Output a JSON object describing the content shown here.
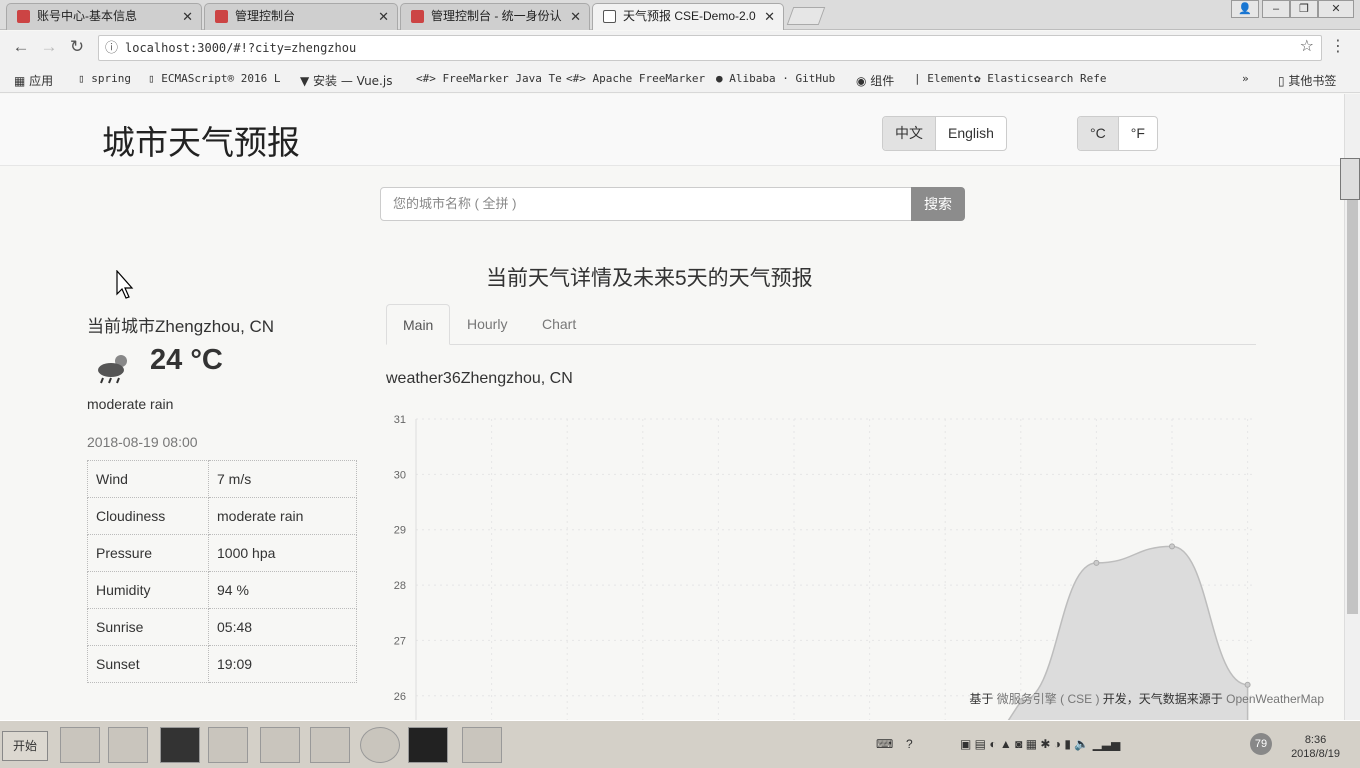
{
  "browser": {
    "tabs": [
      {
        "title": "账号中心-基本信息"
      },
      {
        "title": "管理控制台"
      },
      {
        "title": "管理控制台 - 统一身份认"
      },
      {
        "title": "天气预报 CSE-Demo-2.0"
      }
    ],
    "url": "localhost:3000/#!?city=zhengzhou",
    "bookmarks": [
      "应用",
      "spring",
      "ECMAScript® 2016 L",
      "安装 — Vue.js",
      "FreeMarker Java Te",
      "Apache FreeMarker",
      "Alibaba · GitHub",
      "组件",
      "Element",
      "Elasticsearch Refe",
      "其他书签"
    ]
  },
  "header": {
    "title": "城市天气预报",
    "lang_options": [
      "中文",
      "English"
    ],
    "unit_options": [
      "°C",
      "°F"
    ]
  },
  "search": {
    "placeholder": "您的城市名称 ( 全拼 )",
    "button": "搜索"
  },
  "section_title": "当前天气详情及未来5天的天气预报",
  "current": {
    "city": "当前城市Zhengzhou, CN",
    "temp": "24 °C",
    "description": "moderate rain",
    "time": "2018-08-19 08:00",
    "details": [
      {
        "k": "Wind",
        "v": "7 m/s"
      },
      {
        "k": "Cloudiness",
        "v": "moderate rain"
      },
      {
        "k": "Pressure",
        "v": "1000 hpa"
      },
      {
        "k": "Humidity",
        "v": "94 %"
      },
      {
        "k": "Sunrise",
        "v": "05:48"
      },
      {
        "k": "Sunset",
        "v": "19:09"
      }
    ]
  },
  "tabs": [
    "Main",
    "Hourly",
    "Chart"
  ],
  "chart_title": "weather36Zhengzhou, CN",
  "chart_data": {
    "type": "area",
    "y_ticks": [
      26,
      27,
      28,
      29,
      30,
      31
    ],
    "ylim": [
      25.4,
      31
    ],
    "x": [
      0,
      1,
      2,
      3,
      4,
      5,
      6,
      7,
      8,
      9,
      10,
      11
    ],
    "values": [
      null,
      null,
      null,
      null,
      null,
      null,
      null,
      null,
      25.9,
      28.4,
      28.7,
      26.2
    ],
    "grid": true,
    "area_color": "#dcdcdc",
    "line_color": "#bdbdbd"
  },
  "footer": {
    "prefix": "基于",
    "link1": "微服务引擎 ( CSE )",
    "middle": "开发，天气数据来源于",
    "link2": "OpenWeatherMap"
  },
  "taskbar": {
    "start": "开始",
    "clock_time": "8:36",
    "clock_date": "2018/8/19",
    "badge": "79"
  }
}
